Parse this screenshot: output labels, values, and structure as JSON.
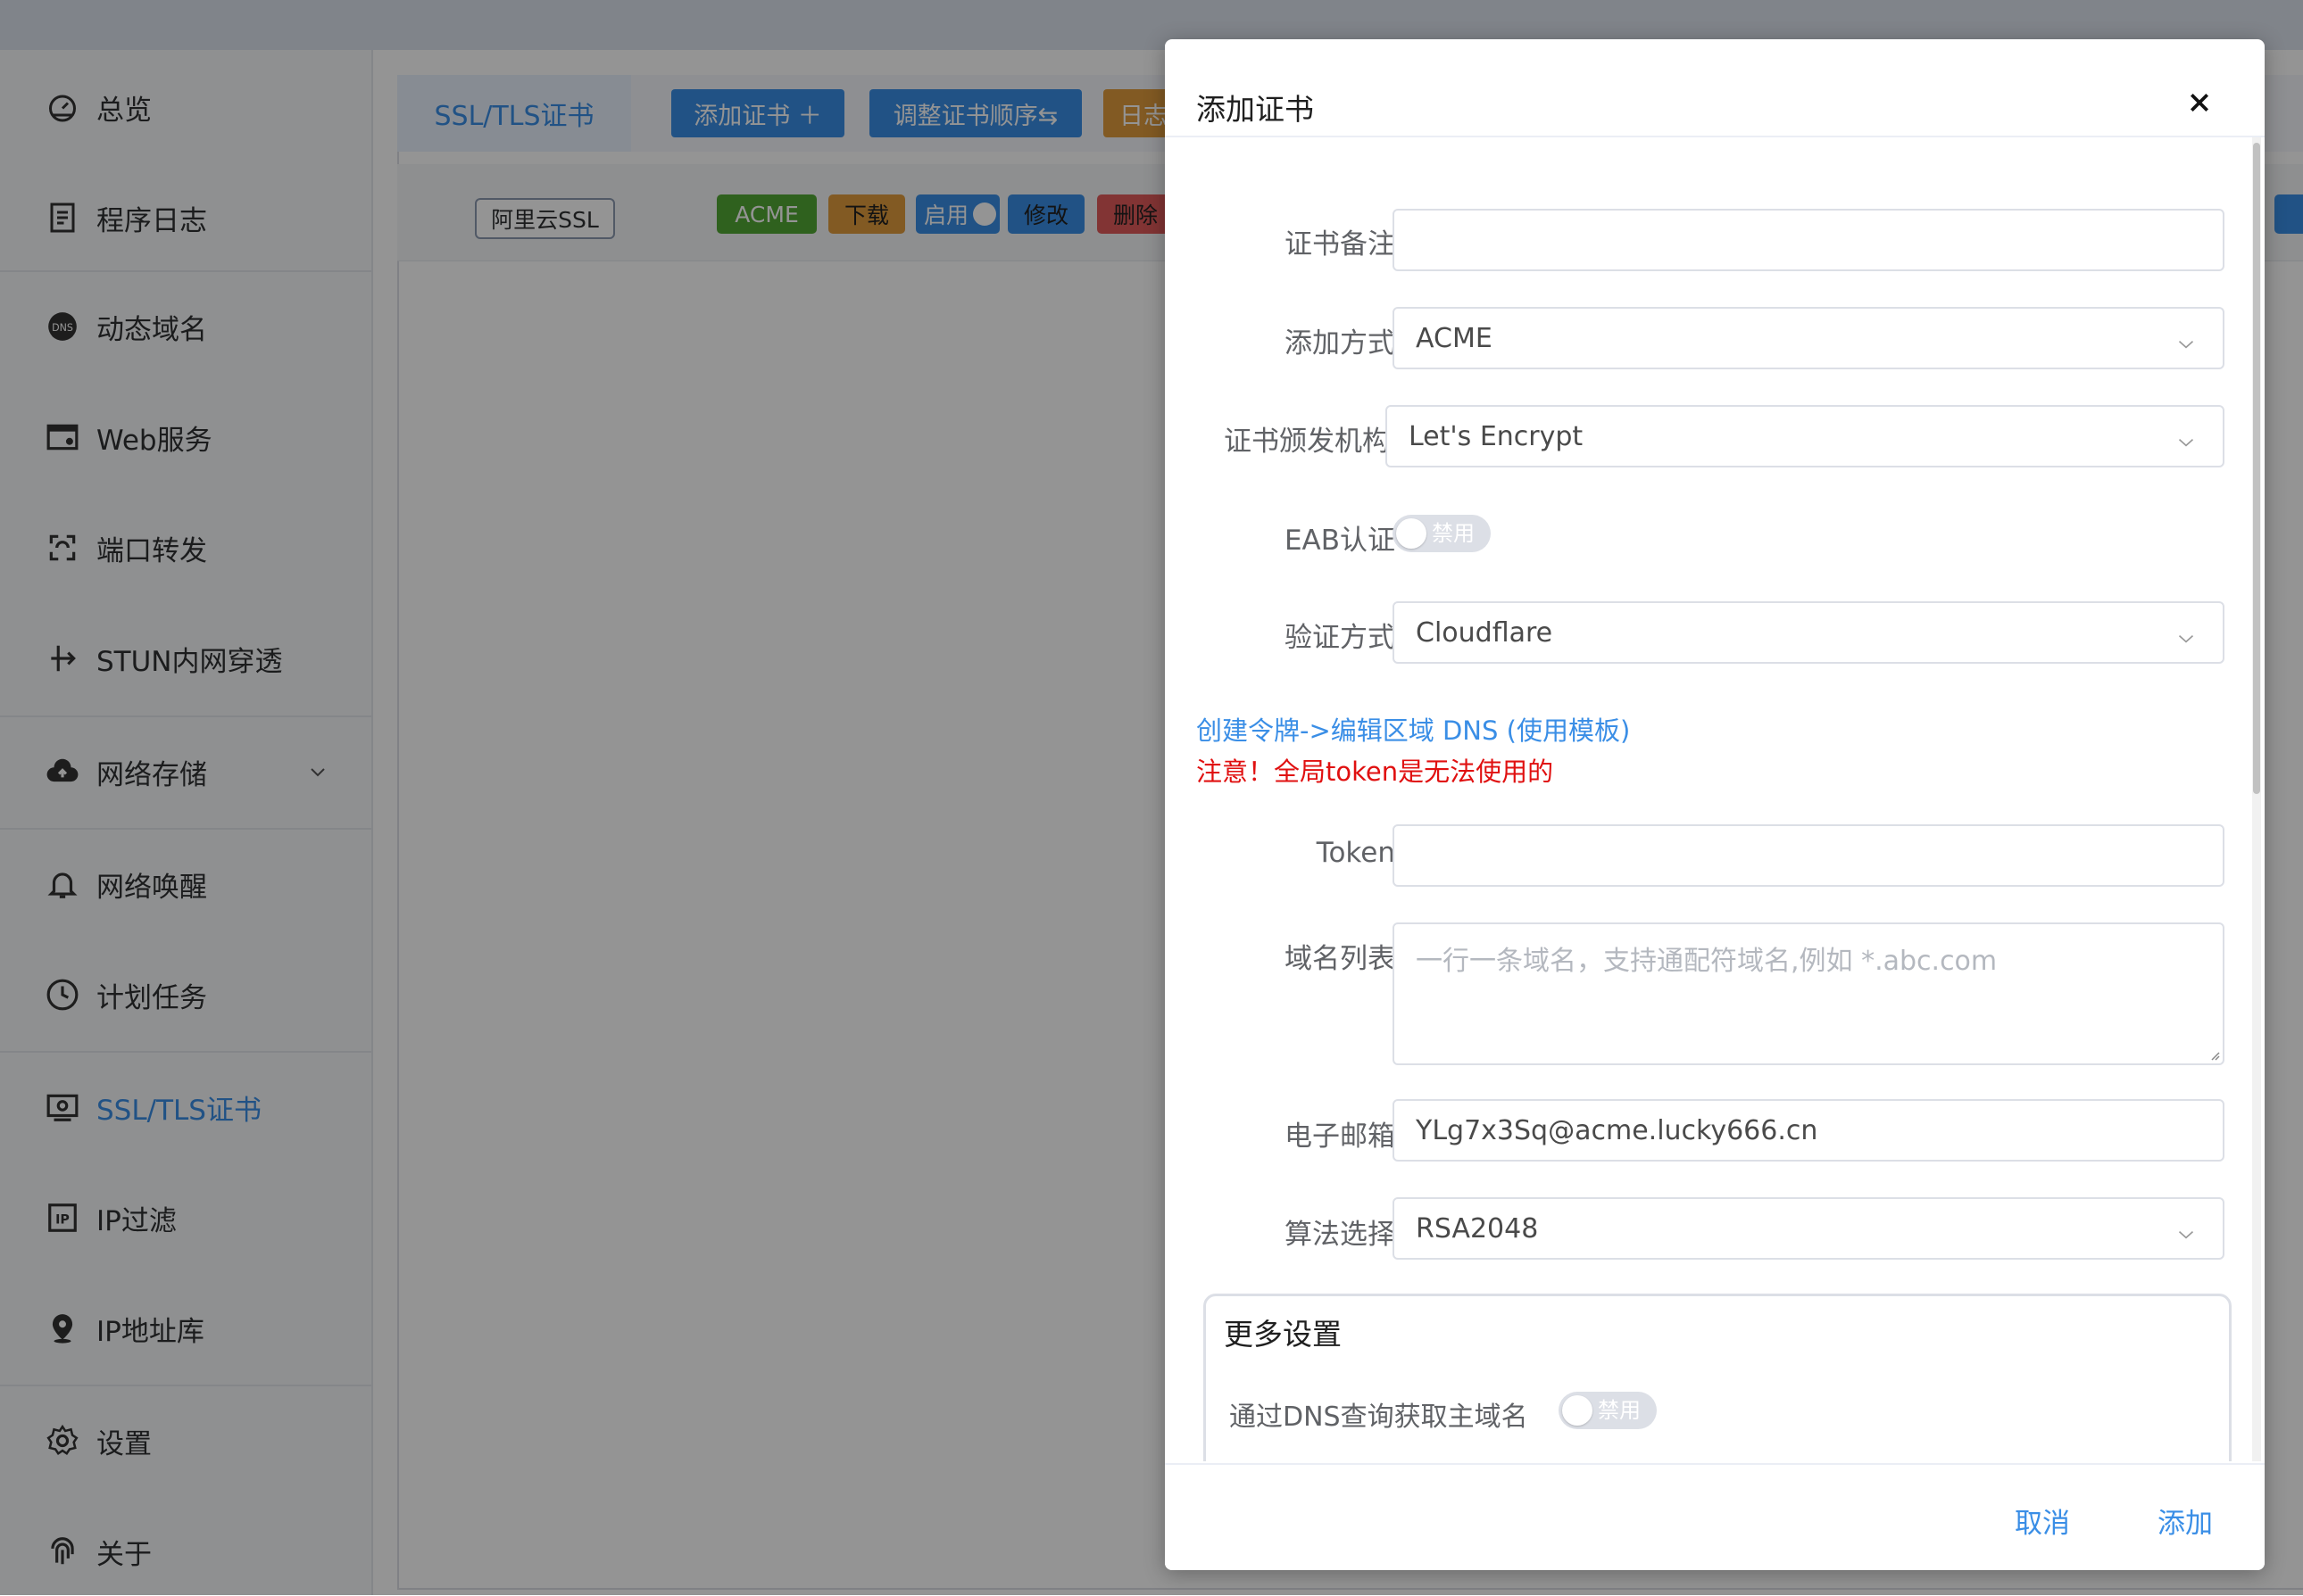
{
  "sidebar": {
    "items": [
      {
        "label": "总览",
        "icon": "dashboard-icon"
      },
      {
        "label": "程序日志",
        "icon": "log-icon"
      },
      {
        "label": "动态域名",
        "icon": "dns-icon"
      },
      {
        "label": "Web服务",
        "icon": "web-icon"
      },
      {
        "label": "端口转发",
        "icon": "port-forward-icon"
      },
      {
        "label": "STUN内网穿透",
        "icon": "stun-icon"
      },
      {
        "label": "网络存储",
        "icon": "cloud-upload-icon"
      },
      {
        "label": "网络唤醒",
        "icon": "bell-icon"
      },
      {
        "label": "计划任务",
        "icon": "clock-icon"
      },
      {
        "label": "SSL/TLS证书",
        "icon": "certificate-icon"
      },
      {
        "label": "IP过滤",
        "icon": "ip-filter-icon"
      },
      {
        "label": "IP地址库",
        "icon": "location-icon"
      },
      {
        "label": "设置",
        "icon": "gear-icon"
      },
      {
        "label": "关于",
        "icon": "fingerprint-icon"
      }
    ],
    "active": "SSL/TLS证书"
  },
  "main": {
    "tab": "SSL/TLS证书",
    "toolbar": {
      "add_cert": "添加证书 ＋",
      "reorder": "调整证书顺序⇆",
      "log": "日志"
    },
    "row": {
      "name": "阿里云SSL",
      "acme": "ACME",
      "download": "下载",
      "enable": "启用",
      "edit": "修改",
      "delete": "删除"
    }
  },
  "dialog": {
    "title": "添加证书",
    "fields": {
      "remark": {
        "label": "证书备注",
        "value": ""
      },
      "method": {
        "label": "添加方式",
        "value": "ACME"
      },
      "ca": {
        "label": "证书颁发机构",
        "value": "Let's Encrypt"
      },
      "eab": {
        "label": "EAB认证",
        "state": "禁用"
      },
      "verify": {
        "label": "验证方式",
        "value": "Cloudflare"
      },
      "link": "创建令牌->编辑区域 DNS (使用模板)",
      "warning": "注意！全局token是无法使用的",
      "token": {
        "label": "Token",
        "value": ""
      },
      "domains": {
        "label": "域名列表",
        "placeholder": "一行一条域名，支持通配符域名,例如 *.abc.com"
      },
      "email": {
        "label": "电子邮箱",
        "value": "YLg7x3Sq@acme.lucky666.cn"
      },
      "algo": {
        "label": "算法选择",
        "value": "RSA2048"
      }
    },
    "more": {
      "title": "更多设置",
      "dns_lookup": {
        "label": "通过DNS查询获取主域名",
        "state": "禁用"
      }
    },
    "footer": {
      "cancel": "取消",
      "confirm": "添加"
    }
  },
  "colors": {
    "accent": "#3a8ee6",
    "acme": "#52a834",
    "download": "#e09b3d",
    "delete": "#e05a5a",
    "warning": "#e01010"
  }
}
